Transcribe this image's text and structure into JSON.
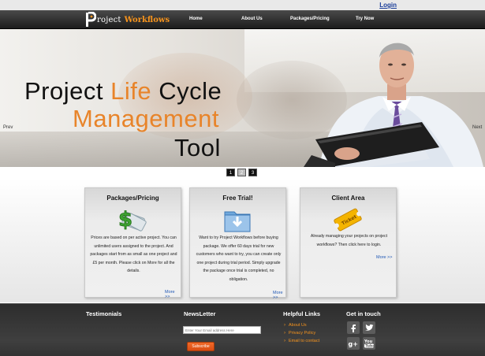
{
  "topbar": {
    "login_label": "Login"
  },
  "header": {
    "logo_letter": "P",
    "logo_word_a": "roject",
    "logo_word_b": "Workflows",
    "nav": [
      "Home",
      "About Us",
      "Packages/Pricing",
      "Try Now"
    ]
  },
  "hero": {
    "title_line1_a": "Project ",
    "title_line1_b": "Life",
    "title_line1_c": " Cycle",
    "title_line2": "Management",
    "title_line3": "Tool",
    "prev_label": "Prev",
    "next_label": "Next",
    "pages": [
      "1",
      "2",
      "3"
    ],
    "active_page": "1"
  },
  "cards": [
    {
      "title": "Packages/Pricing",
      "icon": "money-icon",
      "text": "Prices are based on per active project. You can unlimited users assigned to the project. And packages start from as small as one project and £5 per month. Please click on More for all the details.",
      "more": "More >>"
    },
    {
      "title": "Free Trial!",
      "icon": "download-folder-icon",
      "text": "Want to try Project Workflows before buying package. We offer 60 days trial for new customers who want to try, you can create only one project during trial period. Simply upgrade the package once trial is completed, no obligation.",
      "more": "More >>"
    },
    {
      "title": "Client Area",
      "icon": "ticket-icon",
      "text": "Already managing your projects on project workflows? Then click here to login.",
      "more": "More >>"
    }
  ],
  "footer": {
    "testimonials_heading": "Testimonials",
    "newsletter_heading": "NewsLetter",
    "newsletter_placeholder": "Enter Your Email address Here",
    "subscribe_label": "Subscribe",
    "helpful_heading": "Helpful Links",
    "helpful_links": [
      "About Us",
      "Privacy Policy",
      "Email to contact"
    ],
    "touch_heading": "Get in touch",
    "social": [
      "facebook-icon",
      "twitter-icon",
      "googleplus-icon",
      "youtube-icon"
    ]
  },
  "colors": {
    "accent": "#e8842a",
    "link": "#1f57b5",
    "footer_link": "#f7941d"
  }
}
